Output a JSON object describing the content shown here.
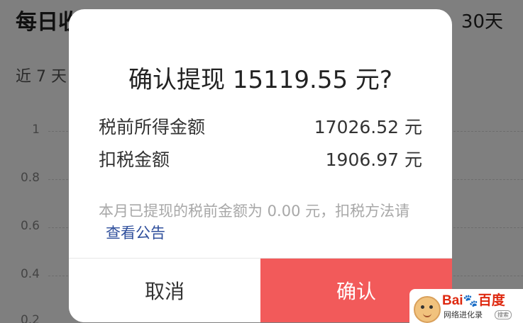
{
  "background": {
    "title": "每日收益",
    "range": "30天",
    "subtitle": "近 7 天",
    "y_ticks": [
      "1",
      "0.8",
      "0.6",
      "0.4",
      "0.2"
    ]
  },
  "dialog": {
    "title": "确认提现 15119.55 元?",
    "rows": [
      {
        "label": "税前所得金额",
        "value": "17026.52 元"
      },
      {
        "label": "扣税金额",
        "value": "1906.97 元"
      }
    ],
    "note": "本月已提现的税前金额为 0.00 元，扣税方法请",
    "note_link": "查看公告",
    "cancel_label": "取消",
    "confirm_label": "确认"
  },
  "watermark": {
    "logo": "Bai",
    "logo_cn": "百度",
    "slogan": "网络进化录",
    "search": "搜索"
  },
  "colors": {
    "confirm_bg": "#f25a5a",
    "link": "#2f4f9c",
    "overlay": "rgba(0,0,0,0.5)"
  }
}
